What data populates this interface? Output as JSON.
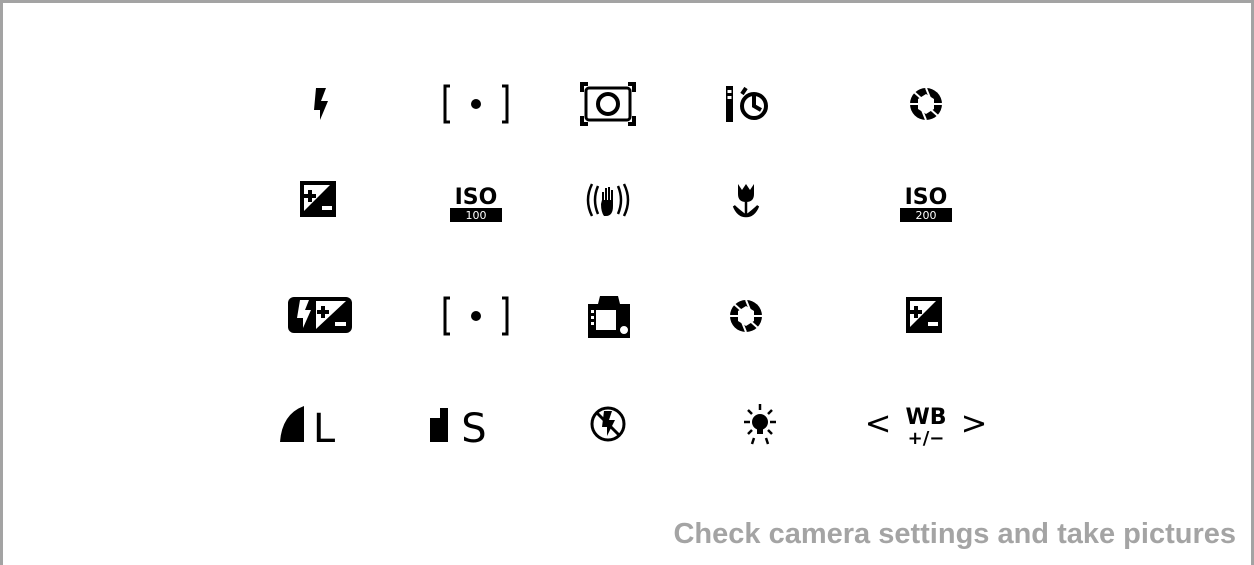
{
  "caption": "Check camera settings and take pictures",
  "icon_text": {
    "iso_1": "ISO",
    "iso_1_value": "100",
    "iso_2": "ISO",
    "iso_2_value": "200",
    "large_quality": "L",
    "small_quality": "S",
    "wb_label": "WB",
    "wb_adjust": "+/−",
    "wb_left": "<",
    "wb_right": ">"
  },
  "icons": [
    [
      "flash-icon",
      "spot-metering-icon",
      "center-weighted-metering-icon",
      "remote-self-timer-icon",
      "aperture-icon"
    ],
    [
      "exposure-compensation-icon",
      "iso-100-icon",
      "vibration-reduction-icon",
      "macro-mode-icon",
      "iso-200-icon"
    ],
    [
      "flash-compensation-icon",
      "spot-metering-icon",
      "camera-body-icon",
      "aperture-icon",
      "exposure-compensation-icon"
    ],
    [
      "image-quality-large-icon",
      "image-quality-small-icon",
      "flash-off-icon",
      "white-balance-incandescent-icon",
      "white-balance-adjust-icon"
    ]
  ],
  "colors": {
    "icon": "#000000",
    "caption": "#a4a4a4",
    "frame": "#a3a3a3",
    "background": "#ffffff"
  }
}
